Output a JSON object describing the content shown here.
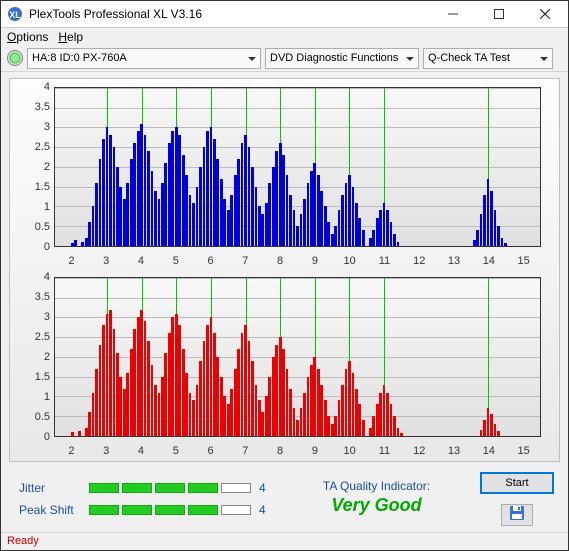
{
  "window": {
    "title": "PlexTools Professional XL V3.16"
  },
  "menu": {
    "options": "Options",
    "help": "Help"
  },
  "toolbar": {
    "drive": "HA:8 ID:0   PX-760A",
    "func": "DVD Diagnostic Functions",
    "test": "Q-Check TA Test"
  },
  "chart_data": [
    {
      "type": "bar",
      "color": "#0000dd",
      "ylim": [
        0,
        4
      ],
      "yticks": [
        0,
        0.5,
        1,
        1.5,
        2,
        2.5,
        3,
        3.5,
        4
      ],
      "xlim": [
        1.5,
        15.5
      ],
      "xticks": [
        2,
        3,
        4,
        5,
        6,
        7,
        8,
        9,
        10,
        11,
        12,
        13,
        14,
        15
      ],
      "vlines": [
        3,
        4,
        5,
        6,
        7,
        8,
        9,
        10,
        11,
        14
      ],
      "bar_width": 0.08,
      "series": [
        {
          "x": 2.0,
          "y": 0.08
        },
        {
          "x": 2.1,
          "y": 0.15
        },
        {
          "x": 2.3,
          "y": 0.1
        },
        {
          "x": 2.4,
          "y": 0.2
        },
        {
          "x": 2.5,
          "y": 0.6
        },
        {
          "x": 2.6,
          "y": 1.0
        },
        {
          "x": 2.7,
          "y": 1.6
        },
        {
          "x": 2.8,
          "y": 2.2
        },
        {
          "x": 2.9,
          "y": 2.7
        },
        {
          "x": 3.0,
          "y": 3.0
        },
        {
          "x": 3.1,
          "y": 2.8
        },
        {
          "x": 3.2,
          "y": 2.5
        },
        {
          "x": 3.3,
          "y": 2.0
        },
        {
          "x": 3.4,
          "y": 1.5
        },
        {
          "x": 3.5,
          "y": 1.2
        },
        {
          "x": 3.6,
          "y": 1.6
        },
        {
          "x": 3.7,
          "y": 2.2
        },
        {
          "x": 3.8,
          "y": 2.6
        },
        {
          "x": 3.9,
          "y": 2.9
        },
        {
          "x": 4.0,
          "y": 3.1
        },
        {
          "x": 4.1,
          "y": 2.8
        },
        {
          "x": 4.2,
          "y": 2.4
        },
        {
          "x": 4.3,
          "y": 1.9
        },
        {
          "x": 4.4,
          "y": 1.4
        },
        {
          "x": 4.5,
          "y": 1.2
        },
        {
          "x": 4.6,
          "y": 1.6
        },
        {
          "x": 4.7,
          "y": 2.1
        },
        {
          "x": 4.8,
          "y": 2.6
        },
        {
          "x": 4.9,
          "y": 2.9
        },
        {
          "x": 5.0,
          "y": 3.0
        },
        {
          "x": 5.1,
          "y": 2.8
        },
        {
          "x": 5.2,
          "y": 2.3
        },
        {
          "x": 5.3,
          "y": 1.8
        },
        {
          "x": 5.4,
          "y": 1.3
        },
        {
          "x": 5.5,
          "y": 1.1
        },
        {
          "x": 5.6,
          "y": 1.5
        },
        {
          "x": 5.7,
          "y": 2.0
        },
        {
          "x": 5.8,
          "y": 2.5
        },
        {
          "x": 5.9,
          "y": 2.9
        },
        {
          "x": 6.0,
          "y": 3.0
        },
        {
          "x": 6.1,
          "y": 2.7
        },
        {
          "x": 6.2,
          "y": 2.2
        },
        {
          "x": 6.3,
          "y": 1.7
        },
        {
          "x": 6.4,
          "y": 1.2
        },
        {
          "x": 6.5,
          "y": 0.9
        },
        {
          "x": 6.6,
          "y": 1.3
        },
        {
          "x": 6.7,
          "y": 1.8
        },
        {
          "x": 6.8,
          "y": 2.2
        },
        {
          "x": 6.9,
          "y": 2.6
        },
        {
          "x": 7.0,
          "y": 2.8
        },
        {
          "x": 7.1,
          "y": 2.5
        },
        {
          "x": 7.2,
          "y": 2.0
        },
        {
          "x": 7.3,
          "y": 1.5
        },
        {
          "x": 7.4,
          "y": 1.0
        },
        {
          "x": 7.5,
          "y": 0.8
        },
        {
          "x": 7.6,
          "y": 1.1
        },
        {
          "x": 7.7,
          "y": 1.6
        },
        {
          "x": 7.8,
          "y": 2.0
        },
        {
          "x": 7.9,
          "y": 2.4
        },
        {
          "x": 8.0,
          "y": 2.6
        },
        {
          "x": 8.1,
          "y": 2.3
        },
        {
          "x": 8.2,
          "y": 1.8
        },
        {
          "x": 8.3,
          "y": 1.3
        },
        {
          "x": 8.4,
          "y": 0.9
        },
        {
          "x": 8.5,
          "y": 0.5
        },
        {
          "x": 8.6,
          "y": 0.8
        },
        {
          "x": 8.7,
          "y": 1.2
        },
        {
          "x": 8.8,
          "y": 1.6
        },
        {
          "x": 8.9,
          "y": 1.9
        },
        {
          "x": 9.0,
          "y": 2.1
        },
        {
          "x": 9.1,
          "y": 1.8
        },
        {
          "x": 9.2,
          "y": 1.4
        },
        {
          "x": 9.3,
          "y": 1.0
        },
        {
          "x": 9.4,
          "y": 0.6
        },
        {
          "x": 9.5,
          "y": 0.3
        },
        {
          "x": 9.6,
          "y": 0.5
        },
        {
          "x": 9.7,
          "y": 0.9
        },
        {
          "x": 9.8,
          "y": 1.3
        },
        {
          "x": 9.9,
          "y": 1.6
        },
        {
          "x": 10.0,
          "y": 1.8
        },
        {
          "x": 10.1,
          "y": 1.5
        },
        {
          "x": 10.2,
          "y": 1.1
        },
        {
          "x": 10.3,
          "y": 0.7
        },
        {
          "x": 10.4,
          "y": 0.4
        },
        {
          "x": 10.6,
          "y": 0.2
        },
        {
          "x": 10.7,
          "y": 0.4
        },
        {
          "x": 10.8,
          "y": 0.7
        },
        {
          "x": 10.9,
          "y": 0.9
        },
        {
          "x": 11.0,
          "y": 1.1
        },
        {
          "x": 11.1,
          "y": 0.9
        },
        {
          "x": 11.2,
          "y": 0.6
        },
        {
          "x": 11.3,
          "y": 0.3
        },
        {
          "x": 11.4,
          "y": 0.1
        },
        {
          "x": 13.6,
          "y": 0.15
        },
        {
          "x": 13.7,
          "y": 0.4
        },
        {
          "x": 13.8,
          "y": 0.8
        },
        {
          "x": 13.9,
          "y": 1.3
        },
        {
          "x": 14.0,
          "y": 1.7
        },
        {
          "x": 14.1,
          "y": 1.4
        },
        {
          "x": 14.2,
          "y": 0.9
        },
        {
          "x": 14.3,
          "y": 0.5
        },
        {
          "x": 14.4,
          "y": 0.2
        },
        {
          "x": 14.5,
          "y": 0.08
        }
      ]
    },
    {
      "type": "bar",
      "color": "#ee0000",
      "ylim": [
        0,
        4
      ],
      "yticks": [
        0,
        0.5,
        1,
        1.5,
        2,
        2.5,
        3,
        3.5,
        4
      ],
      "xlim": [
        1.5,
        15.5
      ],
      "xticks": [
        2,
        3,
        4,
        5,
        6,
        7,
        8,
        9,
        10,
        11,
        12,
        13,
        14,
        15
      ],
      "vlines": [
        3,
        4,
        5,
        6,
        7,
        8,
        9,
        10,
        11,
        14
      ],
      "bar_width": 0.08,
      "series": [
        {
          "x": 2.0,
          "y": 0.1
        },
        {
          "x": 2.2,
          "y": 0.12
        },
        {
          "x": 2.4,
          "y": 0.2
        },
        {
          "x": 2.5,
          "y": 0.6
        },
        {
          "x": 2.6,
          "y": 1.1
        },
        {
          "x": 2.7,
          "y": 1.7
        },
        {
          "x": 2.8,
          "y": 2.3
        },
        {
          "x": 2.9,
          "y": 2.8
        },
        {
          "x": 3.0,
          "y": 3.1
        },
        {
          "x": 3.1,
          "y": 3.2
        },
        {
          "x": 3.2,
          "y": 2.7
        },
        {
          "x": 3.3,
          "y": 2.1
        },
        {
          "x": 3.4,
          "y": 1.5
        },
        {
          "x": 3.5,
          "y": 1.2
        },
        {
          "x": 3.6,
          "y": 1.6
        },
        {
          "x": 3.7,
          "y": 2.2
        },
        {
          "x": 3.8,
          "y": 2.7
        },
        {
          "x": 3.9,
          "y": 3.0
        },
        {
          "x": 4.0,
          "y": 3.2
        },
        {
          "x": 4.1,
          "y": 2.9
        },
        {
          "x": 4.2,
          "y": 2.4
        },
        {
          "x": 4.3,
          "y": 1.8
        },
        {
          "x": 4.4,
          "y": 1.3
        },
        {
          "x": 4.5,
          "y": 1.1
        },
        {
          "x": 4.6,
          "y": 1.5
        },
        {
          "x": 4.7,
          "y": 2.1
        },
        {
          "x": 4.8,
          "y": 2.6
        },
        {
          "x": 4.9,
          "y": 3.0
        },
        {
          "x": 5.0,
          "y": 3.1
        },
        {
          "x": 5.1,
          "y": 2.8
        },
        {
          "x": 5.2,
          "y": 2.2
        },
        {
          "x": 5.3,
          "y": 1.6
        },
        {
          "x": 5.4,
          "y": 1.1
        },
        {
          "x": 5.5,
          "y": 0.9
        },
        {
          "x": 5.6,
          "y": 1.3
        },
        {
          "x": 5.7,
          "y": 1.9
        },
        {
          "x": 5.8,
          "y": 2.4
        },
        {
          "x": 5.9,
          "y": 2.8
        },
        {
          "x": 6.0,
          "y": 3.0
        },
        {
          "x": 6.1,
          "y": 2.6
        },
        {
          "x": 6.2,
          "y": 2.0
        },
        {
          "x": 6.3,
          "y": 1.5
        },
        {
          "x": 6.4,
          "y": 1.0
        },
        {
          "x": 6.5,
          "y": 0.8
        },
        {
          "x": 6.6,
          "y": 1.2
        },
        {
          "x": 6.7,
          "y": 1.7
        },
        {
          "x": 6.8,
          "y": 2.2
        },
        {
          "x": 6.9,
          "y": 2.6
        },
        {
          "x": 7.0,
          "y": 2.8
        },
        {
          "x": 7.1,
          "y": 2.4
        },
        {
          "x": 7.2,
          "y": 1.9
        },
        {
          "x": 7.3,
          "y": 1.3
        },
        {
          "x": 7.4,
          "y": 0.9
        },
        {
          "x": 7.5,
          "y": 0.6
        },
        {
          "x": 7.6,
          "y": 1.0
        },
        {
          "x": 7.7,
          "y": 1.5
        },
        {
          "x": 7.8,
          "y": 2.0
        },
        {
          "x": 7.9,
          "y": 2.3
        },
        {
          "x": 8.0,
          "y": 2.5
        },
        {
          "x": 8.1,
          "y": 2.2
        },
        {
          "x": 8.2,
          "y": 1.7
        },
        {
          "x": 8.3,
          "y": 1.2
        },
        {
          "x": 8.4,
          "y": 0.7
        },
        {
          "x": 8.5,
          "y": 0.4
        },
        {
          "x": 8.6,
          "y": 0.7
        },
        {
          "x": 8.7,
          "y": 1.1
        },
        {
          "x": 8.8,
          "y": 1.5
        },
        {
          "x": 8.9,
          "y": 1.8
        },
        {
          "x": 9.0,
          "y": 2.0
        },
        {
          "x": 9.1,
          "y": 1.7
        },
        {
          "x": 9.2,
          "y": 1.3
        },
        {
          "x": 9.3,
          "y": 0.9
        },
        {
          "x": 9.4,
          "y": 0.5
        },
        {
          "x": 9.5,
          "y": 0.3
        },
        {
          "x": 9.6,
          "y": 0.5
        },
        {
          "x": 9.7,
          "y": 0.9
        },
        {
          "x": 9.8,
          "y": 1.3
        },
        {
          "x": 9.9,
          "y": 1.7
        },
        {
          "x": 10.0,
          "y": 1.9
        },
        {
          "x": 10.1,
          "y": 1.6
        },
        {
          "x": 10.2,
          "y": 1.2
        },
        {
          "x": 10.3,
          "y": 0.8
        },
        {
          "x": 10.4,
          "y": 0.4
        },
        {
          "x": 10.6,
          "y": 0.2
        },
        {
          "x": 10.7,
          "y": 0.5
        },
        {
          "x": 10.8,
          "y": 0.8
        },
        {
          "x": 10.9,
          "y": 1.1
        },
        {
          "x": 11.0,
          "y": 1.3
        },
        {
          "x": 11.1,
          "y": 1.1
        },
        {
          "x": 11.2,
          "y": 0.8
        },
        {
          "x": 11.3,
          "y": 0.5
        },
        {
          "x": 11.4,
          "y": 0.2
        },
        {
          "x": 11.5,
          "y": 0.08
        },
        {
          "x": 13.8,
          "y": 0.15
        },
        {
          "x": 13.9,
          "y": 0.4
        },
        {
          "x": 14.0,
          "y": 0.7
        },
        {
          "x": 14.1,
          "y": 0.55
        },
        {
          "x": 14.2,
          "y": 0.3
        },
        {
          "x": 14.3,
          "y": 0.12
        }
      ]
    }
  ],
  "metrics": {
    "jitter_label": "Jitter",
    "jitter_value": "4",
    "jitter_filled": 4,
    "peak_label": "Peak Shift",
    "peak_value": "4",
    "peak_filled": 4
  },
  "quality": {
    "label": "TA Quality Indicator:",
    "value": "Very Good"
  },
  "actions": {
    "start": "Start"
  },
  "status": "Ready"
}
